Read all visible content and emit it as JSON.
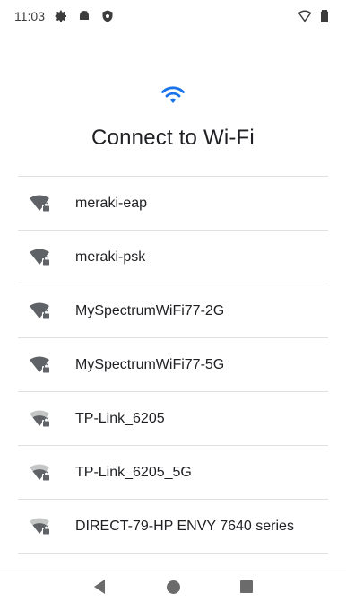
{
  "status_bar": {
    "time": "11:03",
    "left_icons": [
      "gear-icon",
      "android-icon",
      "shield-icon"
    ],
    "right_icons": [
      "wifi-outline-icon",
      "battery-icon"
    ]
  },
  "header": {
    "icon": "wifi-icon",
    "accent_color": "#1a73e8",
    "title": "Connect to Wi-Fi"
  },
  "networks": [
    {
      "name": "meraki-eap",
      "signal": "strong",
      "secured": true
    },
    {
      "name": "meraki-psk",
      "signal": "strong",
      "secured": true
    },
    {
      "name": "MySpectrumWiFi77-2G",
      "signal": "strong",
      "secured": true
    },
    {
      "name": "MySpectrumWiFi77-5G",
      "signal": "strong",
      "secured": true
    },
    {
      "name": "TP-Link_6205",
      "signal": "medium",
      "secured": true
    },
    {
      "name": "TP-Link_6205_5G",
      "signal": "medium",
      "secured": true
    },
    {
      "name": "DIRECT-79-HP ENVY 7640 series",
      "signal": "medium",
      "secured": true
    }
  ],
  "nav_bar": {
    "buttons": [
      "back-icon",
      "home-icon",
      "recents-icon"
    ]
  }
}
